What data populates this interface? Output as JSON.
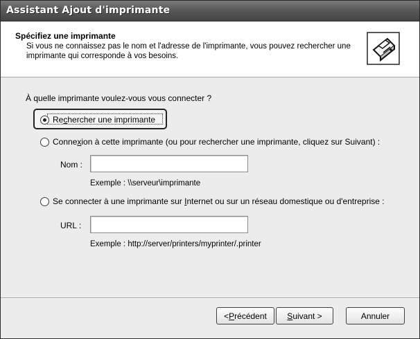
{
  "window": {
    "title": "Assistant Ajout d'imprimante"
  },
  "header": {
    "heading": "Spécifiez une imprimante",
    "description": "Si vous ne connaissez pas le nom et l'adresse de l'imprimante, vous pouvez rechercher une imprimante qui corresponde à vos besoins.",
    "icon": "printer-icon"
  },
  "body": {
    "question": "À quelle imprimante voulez-vous vous connecter ?",
    "options": [
      {
        "label_pre": "Re",
        "label_key": "c",
        "label_post": "hercher une imprimante",
        "checked": true
      },
      {
        "label_pre": "Conne",
        "label_key": "x",
        "label_post": "ion à cette imprimante (ou pour rechercher une imprimante, cliquez sur Suivant) :",
        "checked": false
      },
      {
        "label_pre": "Se connecter à une imprimante sur ",
        "label_key": "I",
        "label_post": "nternet ou sur un réseau domestique ou d'entreprise :",
        "checked": false
      }
    ],
    "name_field": {
      "label": "Nom :",
      "value": "",
      "example": "Exemple : \\\\serveur\\imprimante"
    },
    "url_field": {
      "label": "URL :",
      "value": "",
      "example": "Exemple : http://server/printers/myprinter/.printer"
    }
  },
  "footer": {
    "back": {
      "pre": "< ",
      "key": "P",
      "post": "récédent"
    },
    "next": {
      "pre": "",
      "key": "S",
      "post": "uivant >"
    },
    "cancel": {
      "label": "Annuler"
    }
  }
}
